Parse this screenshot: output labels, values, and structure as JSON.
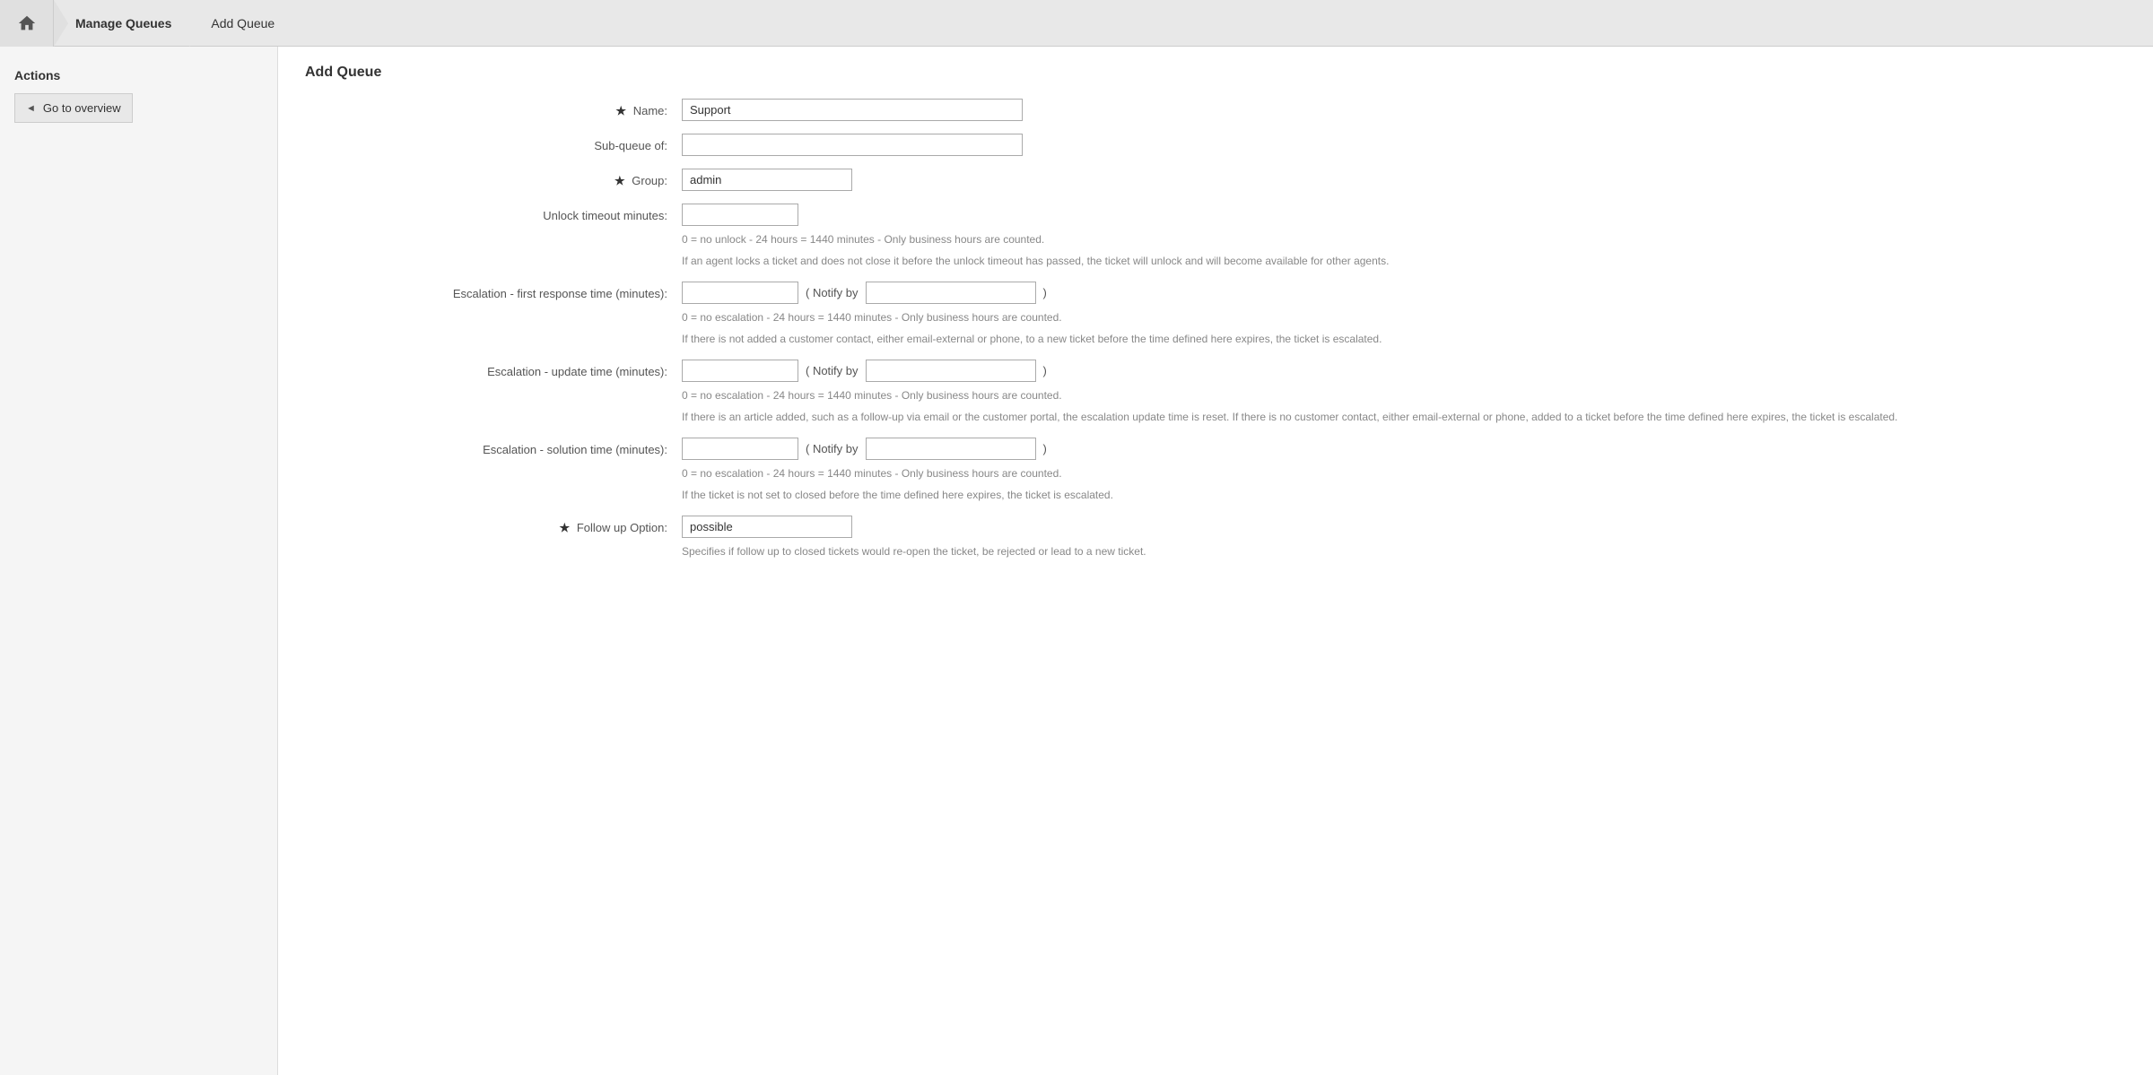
{
  "breadcrumb": {
    "home_icon": "home",
    "items": [
      {
        "label": "Manage Queues",
        "active": true
      },
      {
        "label": "Add Queue",
        "active": false
      }
    ]
  },
  "sidebar": {
    "title": "Actions",
    "buttons": [
      {
        "label": "Go to overview",
        "arrow": "◄"
      }
    ]
  },
  "main": {
    "section_title": "Add Queue",
    "form": {
      "name_label": "Name:",
      "name_required": "★",
      "name_value": "Support",
      "subqueue_label": "Sub-queue of:",
      "subqueue_value": "",
      "group_label": "Group:",
      "group_required": "★",
      "group_value": "admin",
      "unlock_label": "Unlock timeout minutes:",
      "unlock_value": "",
      "unlock_help1": "0 = no unlock - 24 hours = 1440 minutes - Only business hours are counted.",
      "unlock_help2": "If an agent locks a ticket and does not close it before the unlock timeout has passed, the ticket will unlock and will become available for other agents.",
      "esc_first_label": "Escalation - first response time (minutes):",
      "esc_first_value": "",
      "esc_first_notify_label": "( Notify by",
      "esc_first_notify_value": "",
      "esc_first_notify_close": ")",
      "esc_first_help1": "0 = no escalation - 24 hours = 1440 minutes - Only business hours are counted.",
      "esc_first_help2": "If there is not added a customer contact, either email-external or phone, to a new ticket before the time defined here expires, the ticket is escalated.",
      "esc_update_label": "Escalation - update time (minutes):",
      "esc_update_value": "",
      "esc_update_notify_label": "( Notify by",
      "esc_update_notify_value": "",
      "esc_update_notify_close": ")",
      "esc_update_help1": "0 = no escalation - 24 hours = 1440 minutes - Only business hours are counted.",
      "esc_update_help2": "If there is an article added, such as a follow-up via email or the customer portal, the escalation update time is reset. If there is no customer contact, either email-external or phone, added to a ticket before the time defined here expires, the ticket is escalated.",
      "esc_solution_label": "Escalation - solution time (minutes):",
      "esc_solution_value": "",
      "esc_solution_notify_label": "( Notify by",
      "esc_solution_notify_value": "",
      "esc_solution_notify_close": ")",
      "esc_solution_help1": "0 = no escalation - 24 hours = 1440 minutes - Only business hours are counted.",
      "esc_solution_help2": "If the ticket is not set to closed before the time defined here expires, the ticket is escalated.",
      "followup_label": "Follow up Option:",
      "followup_required": "★",
      "followup_value": "possible",
      "followup_help": "Specifies if follow up to closed tickets would re-open the ticket, be rejected or lead to a new ticket."
    }
  }
}
